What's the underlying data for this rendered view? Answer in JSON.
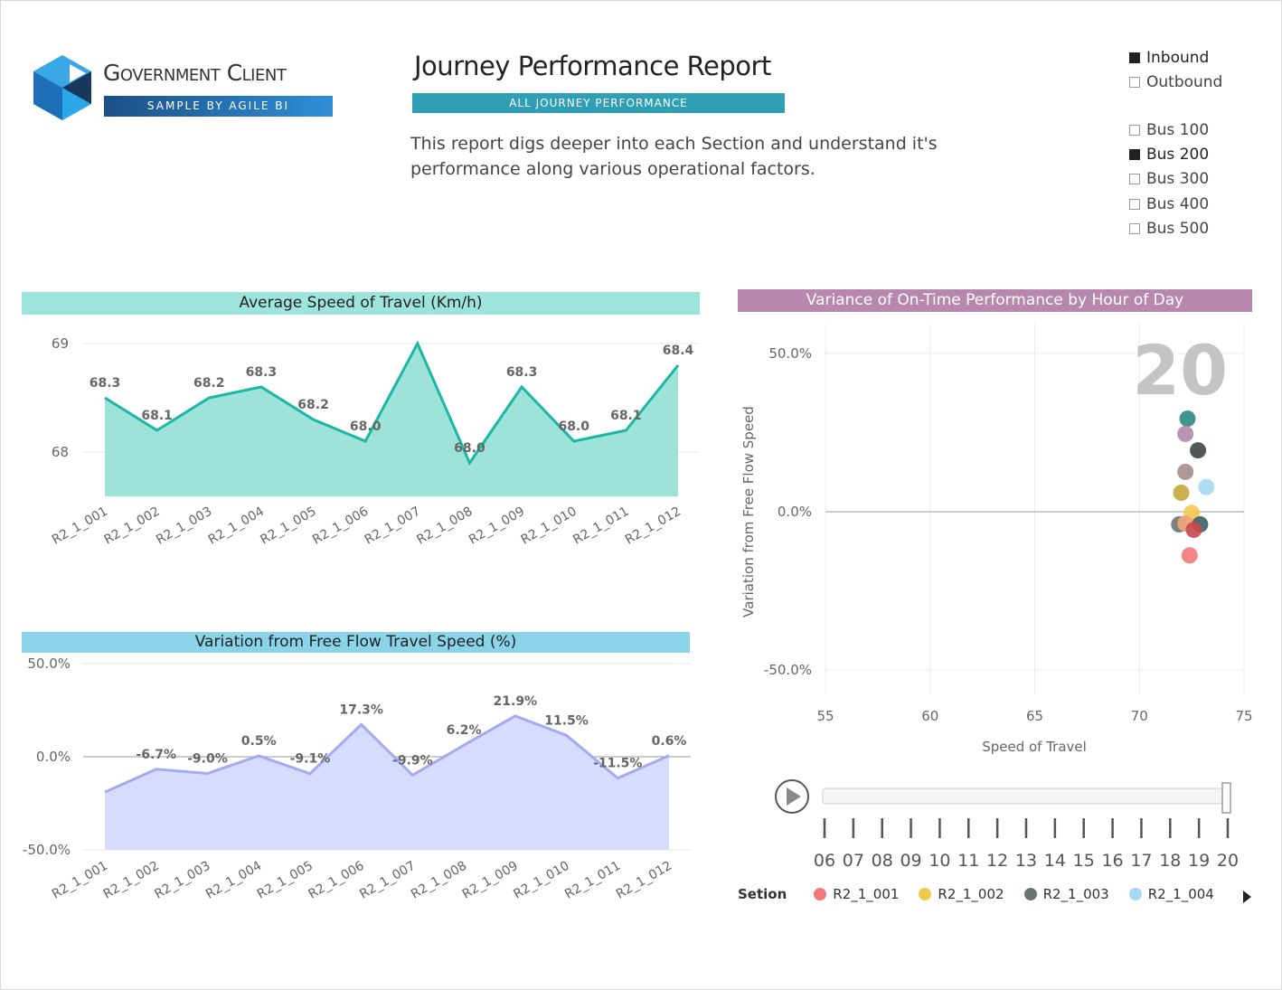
{
  "logo": {
    "title": "Government Client",
    "subtitle": "SAMPLE BY AGILE BI"
  },
  "report": {
    "title": "Journey Performance Report",
    "banner": "ALL JOURNEY PERFORMANCE",
    "description": "This report digs deeper into each Section and understand it's performance along various operational factors."
  },
  "slicers": {
    "direction": [
      {
        "label": "Inbound",
        "checked": true
      },
      {
        "label": "Outbound",
        "checked": false
      }
    ],
    "bus": [
      {
        "label": "Bus 100",
        "checked": false
      },
      {
        "label": "Bus 200",
        "checked": true
      },
      {
        "label": "Bus 300",
        "checked": false
      },
      {
        "label": "Bus 400",
        "checked": false
      },
      {
        "label": "Bus 500",
        "checked": false
      }
    ]
  },
  "colors": {
    "speed_header": "#9de5dc",
    "speed_line": "#1ab7a6",
    "speed_fill": "#9ee3d9",
    "var_header": "#8ad4ea",
    "var_line": "#a3a9f3",
    "var_fill": "#d7dcff",
    "scatter_header": "#b887ad"
  },
  "chart_data": [
    {
      "type": "area",
      "title": "Average Speed of Travel (Km/h)",
      "categories": [
        "R2_1_001",
        "R2_1_002",
        "R2_1_003",
        "R2_1_004",
        "R2_1_005",
        "R2_1_006",
        "R2_1_007",
        "R2_1_008",
        "R2_1_009",
        "R2_1_010",
        "R2_1_011",
        "R2_1_012"
      ],
      "values": [
        68.5,
        68.2,
        68.5,
        68.6,
        68.3,
        68.1,
        69.0,
        67.9,
        68.6,
        68.1,
        68.2,
        68.8
      ],
      "data_labels": [
        "68.3",
        "68.1",
        "68.2",
        "68.3",
        "68.2",
        "68.0",
        "",
        "68.0",
        "68.3",
        "68.0",
        "68.1",
        "68.4"
      ],
      "yticks": [
        "69",
        "68"
      ],
      "ytick_values": [
        69,
        68
      ],
      "ylim": [
        67.6,
        69.1
      ],
      "grid": true
    },
    {
      "type": "area",
      "title": "Variation from Free Flow Travel Speed (%)",
      "categories": [
        "R2_1_001",
        "R2_1_002",
        "R2_1_003",
        "R2_1_004",
        "R2_1_005",
        "R2_1_006",
        "R2_1_007",
        "R2_1_008",
        "R2_1_009",
        "R2_1_010",
        "R2_1_011",
        "R2_1_012"
      ],
      "values": [
        -19.0,
        -6.7,
        -9.0,
        0.5,
        -9.1,
        17.3,
        -9.9,
        6.2,
        21.9,
        11.5,
        -11.5,
        0.6
      ],
      "data_labels": [
        "",
        "-6.7%",
        "-9.0%",
        "0.5%",
        "-9.1%",
        "17.3%",
        "-9.9%",
        "6.2%",
        "21.9%",
        "11.5%",
        "-11.5%",
        "0.6%"
      ],
      "yticks": [
        "50.0%",
        "0.0%",
        "-50.0%"
      ],
      "ytick_values": [
        50,
        0,
        -50
      ],
      "ylim": [
        -50,
        50
      ],
      "grid": true
    },
    {
      "type": "scatter",
      "title": "Variance of On-Time Performance by Hour of Day",
      "xlabel": "Speed of Travel",
      "ylabel": "Variation from Free Flow Speed",
      "xlim": [
        55,
        75
      ],
      "ylim": [
        -50,
        50
      ],
      "xticks": [
        "55",
        "60",
        "65",
        "70",
        "75"
      ],
      "xtick_values": [
        55,
        60,
        65,
        70,
        75
      ],
      "yticks": [
        "50.0%",
        "0.0%",
        "-50.0%"
      ],
      "ytick_values": [
        50,
        0,
        -50
      ],
      "frame_label": "20",
      "points": [
        {
          "x": 72.3,
          "y": 29.4,
          "color": "#2b8a83"
        },
        {
          "x": 72.2,
          "y": 24.6,
          "color": "#b487ac"
        },
        {
          "x": 72.8,
          "y": 19.4,
          "color": "#3e4648"
        },
        {
          "x": 72.2,
          "y": 12.6,
          "color": "#a78d8b"
        },
        {
          "x": 72.0,
          "y": 6.0,
          "color": "#c7a73b"
        },
        {
          "x": 73.2,
          "y": 7.8,
          "color": "#a5d8ee"
        },
        {
          "x": 72.5,
          "y": -0.4,
          "color": "#f2c94c"
        },
        {
          "x": 71.9,
          "y": -4.0,
          "color": "#6b7474"
        },
        {
          "x": 72.2,
          "y": -3.7,
          "color": "#f3a27b"
        },
        {
          "x": 72.9,
          "y": -4.0,
          "color": "#3d5d6b"
        },
        {
          "x": 72.6,
          "y": -5.7,
          "color": "#c94a4a"
        },
        {
          "x": 72.4,
          "y": -13.8,
          "color": "#f07a7a"
        }
      ]
    }
  ],
  "play_axis": {
    "labels": [
      "06",
      "07",
      "08",
      "09",
      "10",
      "11",
      "12",
      "13",
      "14",
      "15",
      "16",
      "17",
      "18",
      "19",
      "20"
    ],
    "value": "20"
  },
  "legend": {
    "title": "Setion",
    "items": [
      {
        "label": "R2_1_001",
        "color": "#f07a7a"
      },
      {
        "label": "R2_1_002",
        "color": "#f2c94c"
      },
      {
        "label": "R2_1_003",
        "color": "#6b7474"
      },
      {
        "label": "R2_1_004",
        "color": "#a5d8ee"
      }
    ]
  },
  "icons": {
    "play": "play-icon",
    "legend_next": "chevron-right-icon"
  }
}
